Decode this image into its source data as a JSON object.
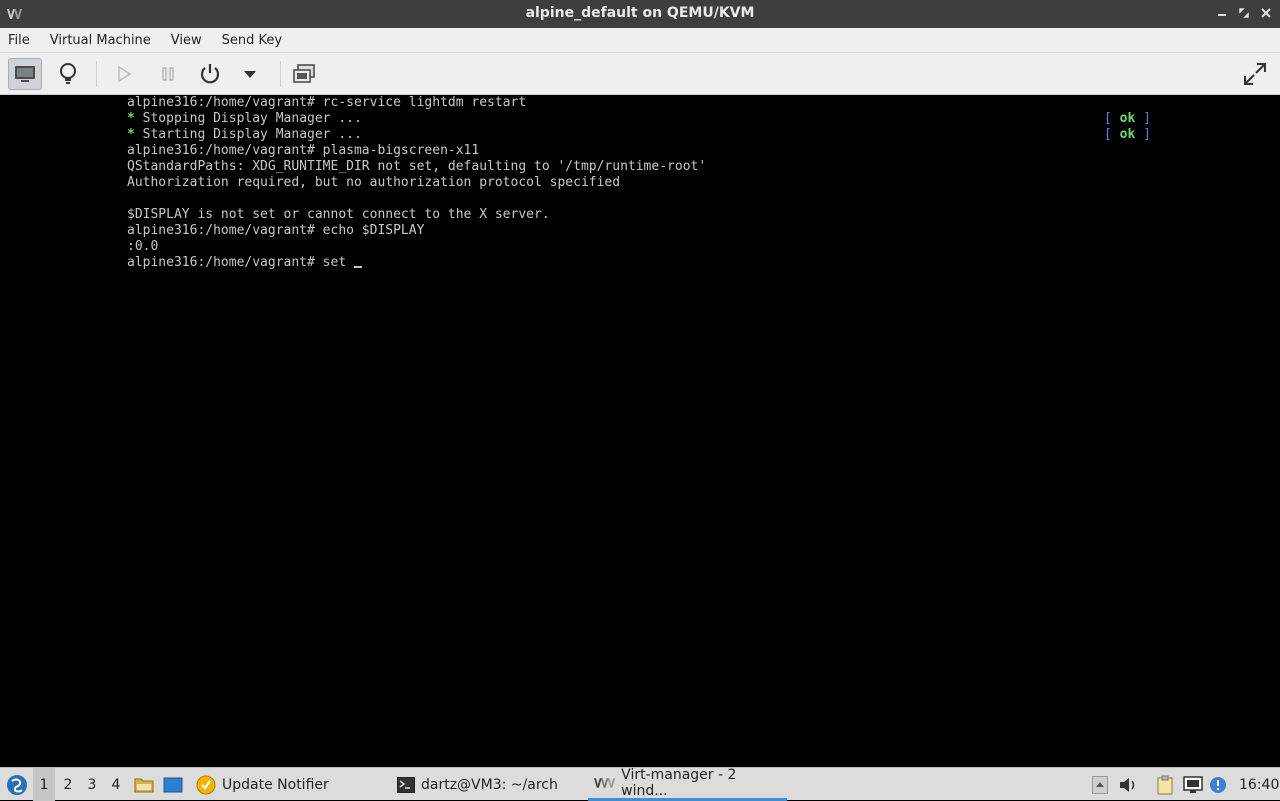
{
  "window": {
    "title": "alpine_default on QEMU/KVM"
  },
  "menubar": {
    "items": [
      "File",
      "Virtual Machine",
      "View",
      "Send Key"
    ]
  },
  "toolbar": {
    "buttons": [
      "monitor-icon",
      "lightbulb-icon",
      "play-icon",
      "pause-icon",
      "power-icon",
      "chevron-down-icon",
      "snapshot-icon",
      "fullscreen-icon"
    ]
  },
  "console": {
    "lines": [
      "alpine316:/home/vagrant# rc-service lightdm restart",
      " Stopping Display Manager ...",
      " Starting Display Manager ...",
      "alpine316:/home/vagrant# plasma-bigscreen-x11",
      "QStandardPaths: XDG_RUNTIME_DIR not set, defaulting to '/tmp/runtime-root'",
      "Authorization required, but no authorization protocol specified",
      "",
      "$DISPLAY is not set or cannot connect to the X server.",
      "alpine316:/home/vagrant# echo $DISPLAY",
      ":0.0",
      "alpine316:/home/vagrant# set "
    ],
    "bullet": "*",
    "status_open": "[",
    "status_word": "ok",
    "status_close": "]"
  },
  "taskbar": {
    "workspaces": [
      "1",
      "2",
      "3",
      "4"
    ],
    "tasks": [
      {
        "label": "Update Notifier",
        "icon": "update-notifier-icon"
      },
      {
        "label": "dartz@VM3: ~/arch",
        "icon": "terminal-icon"
      },
      {
        "label": "Virt-manager - 2 wind...",
        "icon": "virt-manager-icon"
      }
    ],
    "clock": "16:40"
  },
  "colors": {
    "titlebar": "#3c3f41",
    "accent": "#3d8fd4",
    "term_text": "#c8c8c8",
    "term_ok": "#6fdc6f",
    "term_bracket": "#6f7bd8"
  }
}
